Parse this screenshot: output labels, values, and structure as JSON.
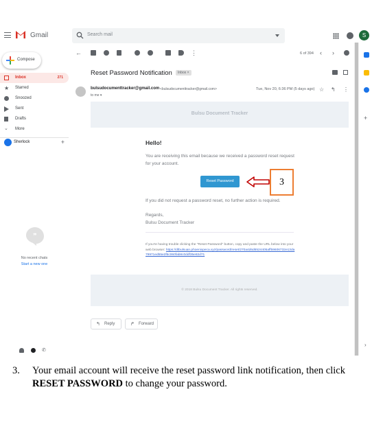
{
  "app": {
    "name": "Gmail",
    "search_placeholder": "Search mail",
    "avatar_initial": "S"
  },
  "sidebar": {
    "compose_label": "Compose",
    "items": [
      {
        "label": "Inbox",
        "count": "271",
        "icon": "inbox-icon"
      },
      {
        "label": "Starred",
        "count": "",
        "icon": "star-icon"
      },
      {
        "label": "Snoozed",
        "count": "",
        "icon": "clock-icon"
      },
      {
        "label": "Sent",
        "count": "",
        "icon": "send-icon"
      },
      {
        "label": "Drafts",
        "count": "",
        "icon": "draft-icon"
      },
      {
        "label": "More",
        "count": "",
        "icon": "chevron-down-icon"
      }
    ],
    "user_name": "Sherlock",
    "no_chats": "No recent chats",
    "start_new": "Start a new one"
  },
  "toolbar": {
    "pager": "6 of 394"
  },
  "message": {
    "subject": "Reset Password Notification",
    "label": "Inbox",
    "sender_name": "bulsudocumenttracker@gmail.com",
    "sender_email": "<bulsudocumenttracker@gmail.com>",
    "to": "to me",
    "date": "Tue, Nov 20, 6:36 PM (5 days ago)",
    "header_title": "Bulsu Document Tracker",
    "greeting": "Hello!",
    "paragraph1": "You are receiving this email because we received a password reset request for your account.",
    "button_label": "Reset Password",
    "paragraph2": "If you did not request a password reset, no further action is required.",
    "regards": "Regards,",
    "signature": "Bulsu Document Tracker",
    "trouble_text": "If you're having trouble clicking the \"Reset Password\" button, copy and paste the URL below into your web browser:",
    "trouble_link": "https://dtbulsuan.phoenixpeca.xyz/password/reset/270a4d6d6524405aff59606732e13da79971ed55e2f6c060fab8c0ddf35e82d71",
    "footer": "© 2018 Bulsu Document Tracker. All rights reserved.",
    "reply_label": "Reply",
    "forward_label": "Forward"
  },
  "annotation": {
    "step": "3",
    "color": "#ed7d31",
    "arrow_color": "#c00000"
  },
  "caption": {
    "number": "3.",
    "text_before": "Your email account will receive the reset password link notification, then click ",
    "bold": "RESET PASSWORD",
    "text_after": " to change your password."
  }
}
